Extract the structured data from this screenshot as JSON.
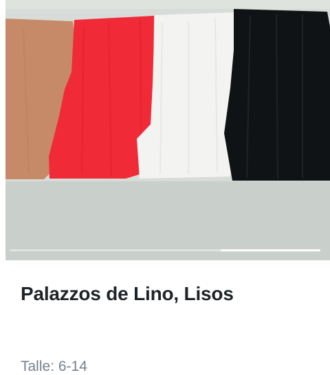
{
  "product": {
    "title": "Palazzos de Lino, Lisos",
    "size": "Talle: 6-14"
  },
  "gallery": {
    "image_alt": "Palazzos de lino en colores camel, rojo, blanco y negro",
    "progress": 0.32,
    "colors": [
      "#c68a68",
      "#f02a36",
      "#f3f4f2",
      "#101315"
    ]
  }
}
